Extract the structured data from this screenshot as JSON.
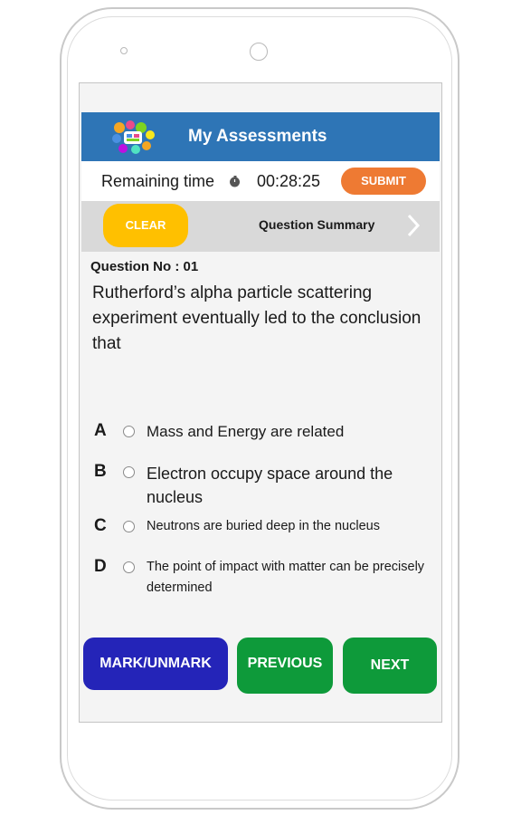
{
  "header": {
    "title": "My Assessments",
    "logo_icon": "colorful-apps-cluster-icon",
    "color": "#2e75b6"
  },
  "timer": {
    "label": "Remaining time",
    "icon": "stopwatch-icon",
    "value": "00:28:25"
  },
  "submit": {
    "label": "SUBMIT",
    "color": "#ee7a33"
  },
  "toolbar": {
    "clear_label": "CLEAR",
    "clear_color": "#ffc000",
    "summary_label": "Question Summary",
    "summary_icon": "chevron-right-icon"
  },
  "question": {
    "number_label": "Question No : 01",
    "text": "Rutherford’s alpha particle scattering experiment eventually led to the conclusion that"
  },
  "options": [
    {
      "letter": "A",
      "text": "Mass and Energy are related",
      "selected": false
    },
    {
      "letter": "B",
      "text": "Electron occupy space around the nucleus",
      "selected": false
    },
    {
      "letter": "C",
      "text": "Neutrons are buried deep in the nucleus",
      "selected": false
    },
    {
      "letter": "D",
      "text": "The point of impact with matter can be precisely determined",
      "selected": false
    }
  ],
  "nav": {
    "mark_label": "MARK/UNMARK",
    "previous_label": "PREVIOUS",
    "next_label": "NEXT",
    "mark_color": "#2424b8",
    "nav_color": "#0e9a3a"
  }
}
